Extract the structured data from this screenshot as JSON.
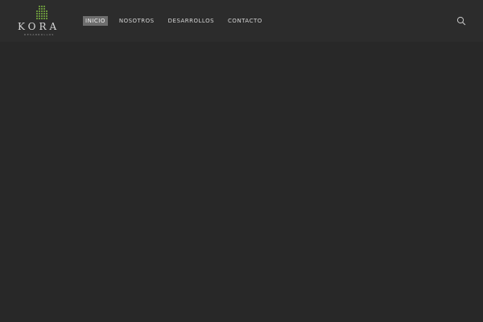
{
  "brand": {
    "name": "KORA",
    "tagline": "DESARROLLOS",
    "accent_color": "#7cb342"
  },
  "nav": {
    "items": [
      {
        "label": "INICIO",
        "active": true
      },
      {
        "label": "NOSOTROS",
        "active": false
      },
      {
        "label": "DESARROLLOS",
        "active": false
      },
      {
        "label": "CONTACTO",
        "active": false
      }
    ]
  },
  "search": {
    "icon": "search-icon"
  }
}
